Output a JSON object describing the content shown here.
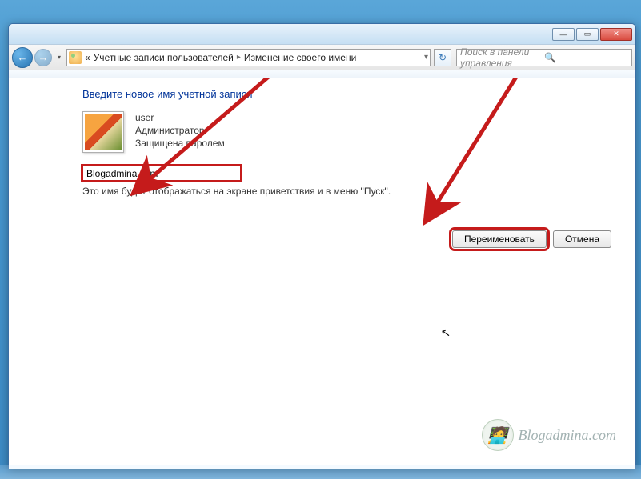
{
  "titlebar": {
    "min": "—",
    "max": "▭",
    "close": "✕"
  },
  "nav": {
    "back": "←",
    "fwd": "→",
    "dd": "▾"
  },
  "address": {
    "prefix": "«",
    "seg1": "Учетные записи пользователей",
    "seg2": "Изменение своего имени",
    "chev": "▸",
    "dd": "▾",
    "refresh": "↻"
  },
  "search": {
    "placeholder": "Поиск в панели управления",
    "icon": "🔍"
  },
  "heading": "Введите новое имя учетной записи",
  "user": {
    "name": "user",
    "role": "Администратор",
    "status": "Защищена паролем"
  },
  "input_value": "Blogadmina.com",
  "hint": "Это имя будет отображаться на экране приветствия и в меню \"Пуск\".",
  "buttons": {
    "rename": "Переименовать",
    "cancel": "Отмена"
  },
  "watermark": {
    "text": "Blogadmina.com",
    "emoji": "🧑‍💻"
  }
}
